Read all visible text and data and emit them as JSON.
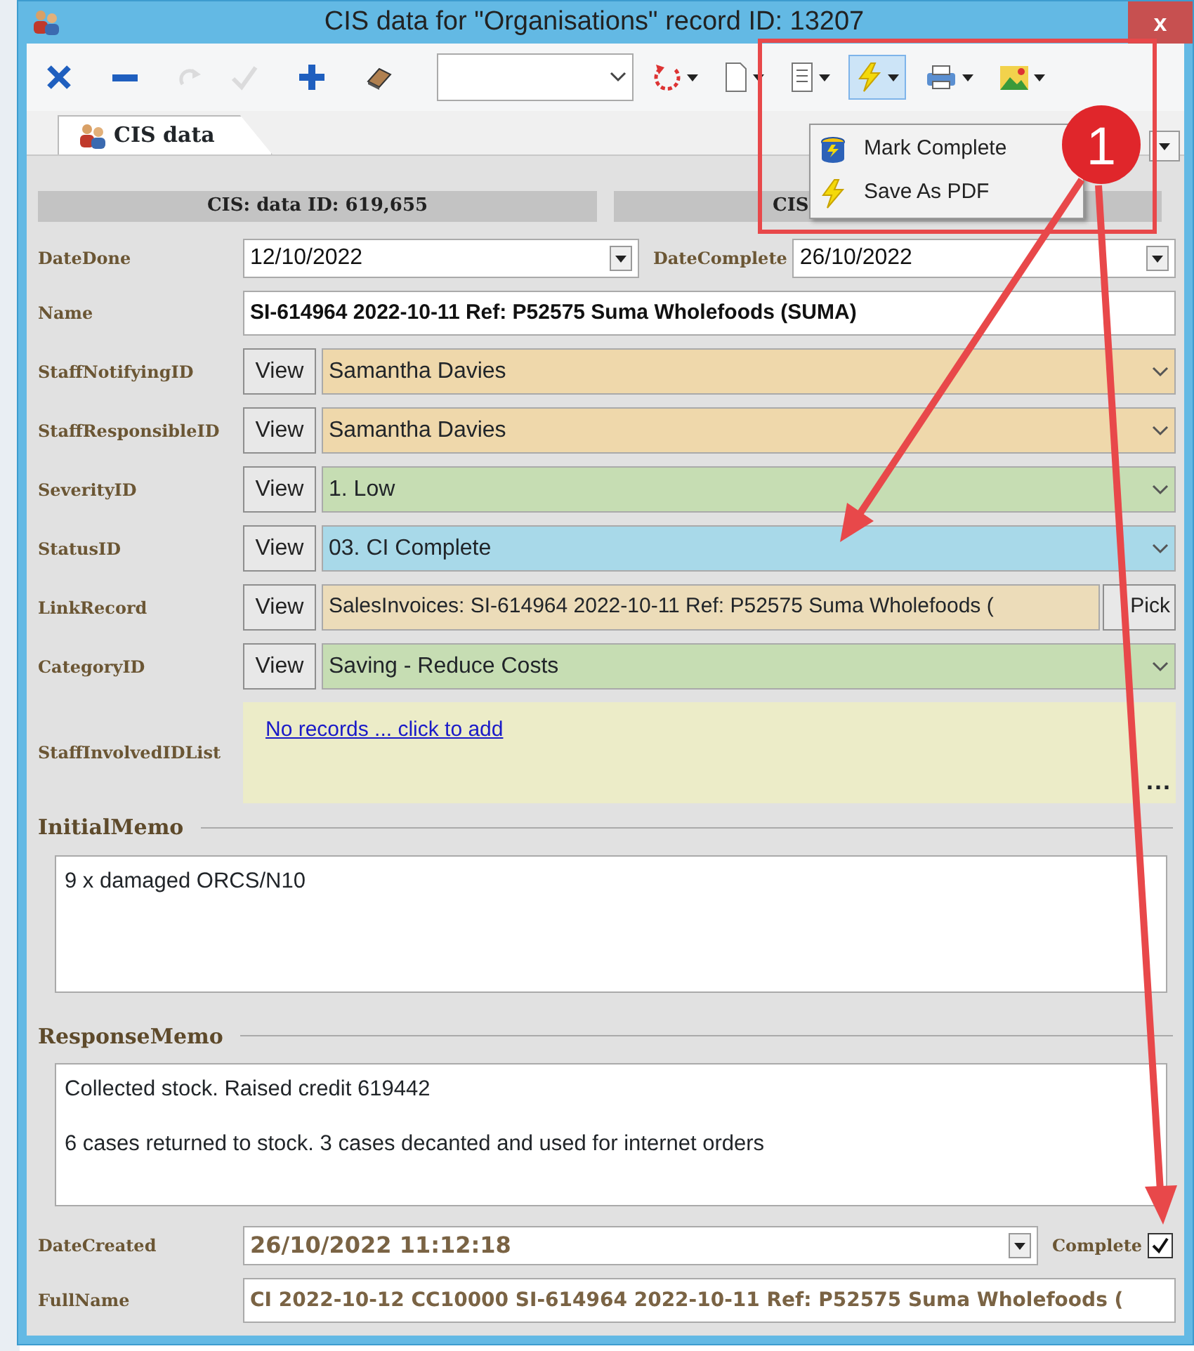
{
  "window": {
    "title": "CIS data for \"Organisations\" record ID: 13207",
    "close": "x"
  },
  "toolbar": [
    {
      "kind": "delete",
      "disabled": false,
      "pressed": false,
      "dropdown": false
    },
    {
      "kind": "remove",
      "disabled": false,
      "pressed": false,
      "dropdown": false
    },
    {
      "kind": "redo",
      "disabled": true,
      "pressed": false,
      "dropdown": false
    },
    {
      "kind": "accept",
      "disabled": true,
      "pressed": false,
      "dropdown": false
    },
    {
      "kind": "add",
      "disabled": false,
      "pressed": false,
      "dropdown": false
    },
    {
      "kind": "eraser",
      "disabled": false,
      "pressed": false,
      "dropdown": false
    },
    {
      "kind": "combo",
      "disabled": false,
      "pressed": false,
      "dropdown": true
    },
    {
      "kind": "refresh",
      "disabled": false,
      "pressed": false,
      "dropdown": true
    },
    {
      "kind": "document",
      "disabled": false,
      "pressed": false,
      "dropdown": true
    },
    {
      "kind": "report",
      "disabled": false,
      "pressed": false,
      "dropdown": true
    },
    {
      "kind": "lightning",
      "disabled": false,
      "pressed": true,
      "dropdown": true
    },
    {
      "kind": "print",
      "disabled": false,
      "pressed": false,
      "dropdown": true
    },
    {
      "kind": "picture",
      "disabled": false,
      "pressed": false,
      "dropdown": true
    }
  ],
  "menu": [
    {
      "kind": "database",
      "label": "Mark Complete"
    },
    {
      "kind": "lightning",
      "label": "Save As PDF"
    }
  ],
  "tabs": [
    {
      "label": "CIS data",
      "selected": true
    }
  ],
  "header": [
    "CIS: data ID: 619,655",
    "CIS"
  ],
  "fields": [
    {
      "kind": "date_pair",
      "label": "DateDone",
      "value": "12/10/2022",
      "label_2": "DateComplete",
      "value_2": "26/10/2022"
    },
    {
      "kind": "text",
      "label": "Name",
      "value": "SI-614964 2022-10-11 Ref: P52575 Suma Wholefoods (SUMA)"
    },
    {
      "kind": "lookup",
      "label": "StaffNotifyingID",
      "button": "View",
      "value": "Samantha Davies",
      "color": "#efd8ab"
    },
    {
      "kind": "lookup",
      "label": "StaffResponsibleID",
      "button": "View",
      "value": "Samantha Davies",
      "color": "#efd8ab"
    },
    {
      "kind": "lookup",
      "label": "SeverityID",
      "button": "View",
      "value": "1. Low",
      "color": "#c6ddb3"
    },
    {
      "kind": "lookup",
      "label": "StatusID",
      "button": "View",
      "value": "03. CI Complete",
      "color": "#a8d9e9"
    },
    {
      "kind": "link",
      "label": "LinkRecord",
      "button": "View",
      "value": "SalesInvoices: SI-614964 2022-10-11 Ref: P52575 Suma Wholefoods (",
      "action": "Pick",
      "color": "#ecdcb9"
    },
    {
      "kind": "lookup",
      "label": "CategoryID",
      "button": "View",
      "value": "Saving - Reduce Costs",
      "color": "#c6ddb3"
    },
    {
      "kind": "list",
      "label": "StaffInvolvedIDList",
      "link": "No records ... click to add",
      "more": "..."
    }
  ],
  "memos": [
    {
      "title": "InitialMemo",
      "paragraphs": [
        "9 x damaged ORCS/N10"
      ]
    },
    {
      "title": "ResponseMemo",
      "paragraphs": [
        "Collected stock. Raised credit 619442",
        "6 cases returned to stock. 3 cases decanted and used for internet orders"
      ]
    }
  ],
  "footer": {
    "date_label": "DateCreated",
    "date_value": "26/10/2022 11:12:18",
    "check_label": "Complete",
    "checked": true,
    "name_label": "FullName",
    "name_value": "CI 2022-10-12 CC10000 SI-614964 2022-10-11 Ref: P52575 Suma Wholefoods ("
  },
  "annotation": {
    "callout": "1"
  }
}
